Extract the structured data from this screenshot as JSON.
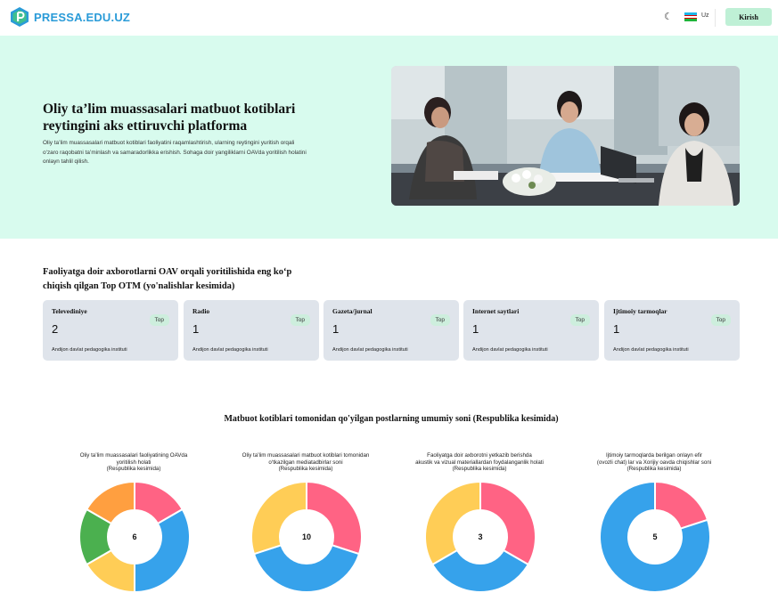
{
  "header": {
    "site_name": "PRESSA.EDU.UZ",
    "theme_icon": "moon-icon",
    "language": "Uz",
    "login_label": "Kirish",
    "flag_colors": [
      "#1eb5e8",
      "#ffffff",
      "#1eb53a"
    ]
  },
  "hero": {
    "title": "Oliy ta’lim muassasalari matbuot kotiblari reytingini aks ettiruvchi platforma",
    "description": "Oliy ta’lim muassasalari matbuot kotiblari faoliyatini raqamlashtirish, ularning reytingini yuritish orqali o‘zaro raqobatni ta’minlash va samaradorlikka erishish. Sohaga doir yangiliklarni OAVda yoritilish holatini onlayn tahlil qilish.",
    "background": "#d8fbee"
  },
  "top_section": {
    "title": "Faoliyatga doir axborotlarni OAV orqali yoritilishida eng ko‘p chiqish qilgan Top OTM (yo'nalishlar kesimida)",
    "cards": [
      {
        "title": "Televediniye",
        "badge": "Top",
        "value": "2",
        "institution": "Andijon davlat pedagogika instituti"
      },
      {
        "title": "Radio",
        "badge": "Top",
        "value": "1",
        "institution": "Andijon davlat pedagogika instituti"
      },
      {
        "title": "Gazeta/jurnal",
        "badge": "Top",
        "value": "1",
        "institution": "Andijon davlat pedagogika instituti"
      },
      {
        "title": "Internet saytlari",
        "badge": "Top",
        "value": "1",
        "institution": "Andijon davlat pedagogika instituti"
      },
      {
        "title": "Ijtimoiy tarmoqlar",
        "badge": "Top",
        "value": "1",
        "institution": "Andijon davlat pedagogika instituti"
      }
    ]
  },
  "charts_section": {
    "title": "Matbuot kotiblari tomonidan qo'yilgan postlarning umumiy soni (Respublika kesimida)"
  },
  "chart_data": [
    {
      "type": "pie",
      "title_lines": [
        "Oliy ta’lim muassasalari faoliyatining OAVda",
        "yoritilish holati",
        "(Respublika kesimida)"
      ],
      "center_label": "6",
      "values": [
        1,
        2,
        1,
        1,
        1
      ],
      "colors": [
        "#ff6384",
        "#36a2eb",
        "#ffcd56",
        "#4bb04f",
        "#ff9f40"
      ]
    },
    {
      "type": "pie",
      "title_lines": [
        "Oliy ta’lim muassasalari matbuot kotiblari tomonidan",
        "o‘tkazilgan  mediatadbirlar soni",
        "(Respublika kesimida)"
      ],
      "center_label": "10",
      "values": [
        3,
        4,
        3
      ],
      "colors": [
        "#ff6384",
        "#36a2eb",
        "#ffcd56"
      ]
    },
    {
      "type": "pie",
      "title_lines": [
        "Faoliyatga doir axborotni yetkazib berishda",
        "akustik va vizual  materiallardan foydalanganlik holati",
        "(Respublika kesimida)"
      ],
      "center_label": "3",
      "values": [
        1,
        1,
        1
      ],
      "colors": [
        "#ff6384",
        "#36a2eb",
        "#ffcd56"
      ]
    },
    {
      "type": "pie",
      "title_lines": [
        "Ijtimoiy tarmoqlarda berilgan onlayn efir",
        "(ovozli chat) lar va Xorijiy oavda chiqishlar soni",
        "(Respublika kesimida)"
      ],
      "center_label": "5",
      "values": [
        1,
        4
      ],
      "colors": [
        "#ff6384",
        "#36a2eb"
      ]
    }
  ]
}
